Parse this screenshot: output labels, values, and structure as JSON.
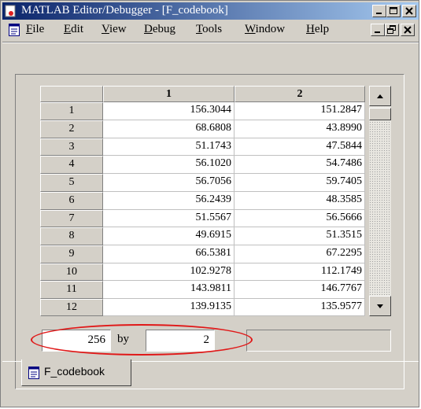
{
  "window": {
    "title": "MATLAB Editor/Debugger - [F_codebook]",
    "titlebar_colors": [
      "#0a246a",
      "#a6caf0"
    ]
  },
  "menu": [
    "File",
    "Edit",
    "View",
    "Debug",
    "Tools",
    "Window",
    "Help"
  ],
  "menu_mnemonics": [
    "F",
    "E",
    "V",
    "D",
    "T",
    "W",
    "H"
  ],
  "table": {
    "columns": [
      "1",
      "2"
    ],
    "rows": [
      {
        "label": "1",
        "c1": "156.3044",
        "c2": "151.2847"
      },
      {
        "label": "2",
        "c1": "68.6808",
        "c2": "43.8990"
      },
      {
        "label": "3",
        "c1": "51.1743",
        "c2": "47.5844"
      },
      {
        "label": "4",
        "c1": "56.1020",
        "c2": "54.7486"
      },
      {
        "label": "5",
        "c1": "56.7056",
        "c2": "59.7405"
      },
      {
        "label": "6",
        "c1": "56.2439",
        "c2": "48.3585"
      },
      {
        "label": "7",
        "c1": "51.5567",
        "c2": "56.5666"
      },
      {
        "label": "8",
        "c1": "49.6915",
        "c2": "51.3515"
      },
      {
        "label": "9",
        "c1": "66.5381",
        "c2": "67.2295"
      },
      {
        "label": "10",
        "c1": "102.9278",
        "c2": "112.1749"
      },
      {
        "label": "11",
        "c1": "143.9811",
        "c2": "146.7767"
      },
      {
        "label": "12",
        "c1": "139.9135",
        "c2": "135.9577"
      }
    ]
  },
  "size": {
    "rows": "256",
    "by_label": "by",
    "cols": "2"
  },
  "annotation_color": "#e01818",
  "tab": {
    "label": "F_codebook"
  }
}
